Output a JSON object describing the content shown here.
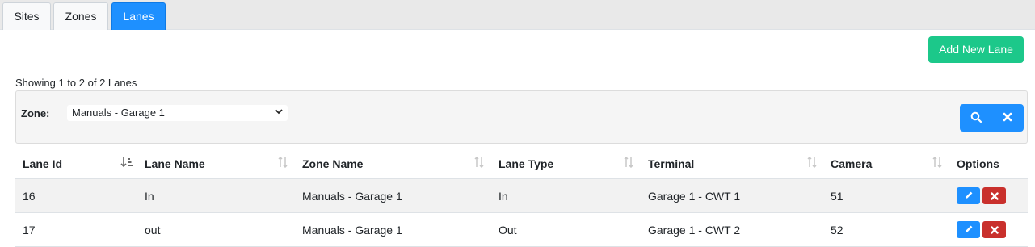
{
  "tabs": [
    {
      "label": "Sites",
      "active": false
    },
    {
      "label": "Zones",
      "active": false
    },
    {
      "label": "Lanes",
      "active": true
    }
  ],
  "toolbar": {
    "add_label": "Add New Lane"
  },
  "summary": "Showing 1 to 2 of 2 Lanes",
  "filter": {
    "zone_label": "Zone:",
    "zone_value": "Manuals - Garage 1",
    "search_icon": "search-icon",
    "clear_icon": "close-icon"
  },
  "table": {
    "columns": [
      "Lane Id",
      "Lane Name",
      "Zone Name",
      "Lane Type",
      "Terminal",
      "Camera",
      "Options"
    ],
    "rows": [
      {
        "lane_id": "16",
        "lane_name": "In",
        "zone_name": "Manuals - Garage 1",
        "lane_type": "In",
        "terminal": "Garage 1 - CWT 1",
        "camera": "51"
      },
      {
        "lane_id": "17",
        "lane_name": "out",
        "zone_name": "Manuals - Garage 1",
        "lane_type": "Out",
        "terminal": "Garage 1 - CWT 2",
        "camera": "52"
      }
    ]
  },
  "colors": {
    "primary": "#1e90ff",
    "success": "#1cc88a",
    "danger": "#c9302c"
  }
}
